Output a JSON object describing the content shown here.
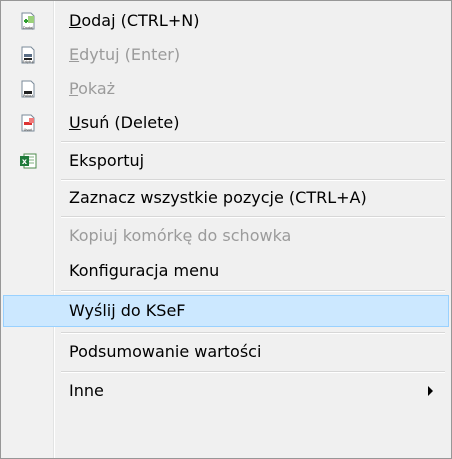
{
  "menu": {
    "items": [
      {
        "label_underline": "D",
        "label_rest": "odaj (CTRL+N)",
        "icon": "document-add-icon",
        "icon_caption": "Dodaj",
        "enabled": true
      },
      {
        "label_underline": "E",
        "label_rest": "dytuj (Enter)",
        "icon": "document-edit-icon",
        "icon_caption": "Edytuj",
        "enabled": false
      },
      {
        "label_underline": "P",
        "label_rest": "okaż",
        "icon": "document-view-icon",
        "icon_caption": "Pokaż",
        "enabled": false
      },
      {
        "label_underline": "U",
        "label_rest": "suń (Delete)",
        "icon": "document-delete-icon",
        "icon_caption": "Usuń",
        "enabled": true
      },
      {
        "label": "Eksportuj",
        "icon": "excel-export-icon",
        "enabled": true
      },
      {
        "label": "Zaznacz wszystkie pozycje (CTRL+A)",
        "enabled": true
      },
      {
        "label": "Kopiuj komórkę do schowka",
        "enabled": false
      },
      {
        "label": "Konfiguracja menu",
        "enabled": true
      },
      {
        "label": "Wyślij do KSeF",
        "enabled": true,
        "highlighted": true
      },
      {
        "label": "Podsumowanie wartości",
        "enabled": true
      },
      {
        "label": "Inne",
        "enabled": true,
        "has_submenu": true,
        "submenu_icon": "chevron-right-icon"
      }
    ]
  },
  "colors": {
    "highlight_bg": "#cce8ff",
    "highlight_border": "#99d1ff",
    "disabled_text": "#9b9b9b",
    "menu_bg": "#f0f0f0"
  }
}
